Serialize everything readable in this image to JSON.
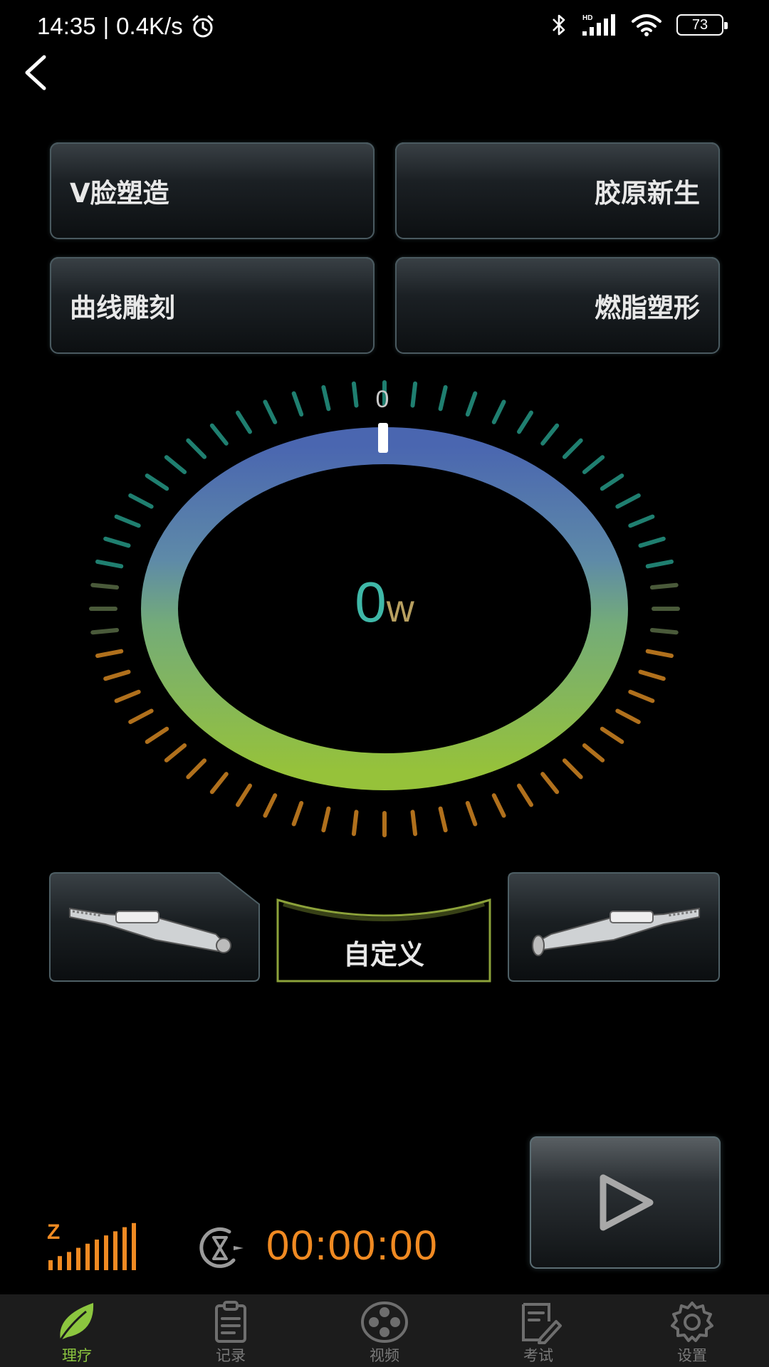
{
  "status_bar": {
    "time": "14:35",
    "speed": "0.4K/s",
    "battery": "73",
    "signal_label": "HD"
  },
  "modes": {
    "v_face": "V脸塑造",
    "collagen": "胶原新生",
    "curve": "曲线雕刻",
    "fat": "燃脂塑形"
  },
  "gauge": {
    "scale_zero": "0",
    "value": "0",
    "unit": "w",
    "level": 0
  },
  "custom_label": "自定义",
  "intensity_label": "Z",
  "timer": "00:00:00",
  "tabs": [
    {
      "label": "理疗",
      "icon": "leaf-icon",
      "active": true
    },
    {
      "label": "记录",
      "icon": "clipboard-icon",
      "active": false
    },
    {
      "label": "视频",
      "icon": "film-reel-icon",
      "active": false
    },
    {
      "label": "考试",
      "icon": "exam-pen-icon",
      "active": false
    },
    {
      "label": "设置",
      "icon": "gear-icon",
      "active": false
    }
  ],
  "colors": {
    "accent_green": "#8cc63f",
    "timer_orange": "#f08a22",
    "ring_blue": "#4a68b0"
  }
}
